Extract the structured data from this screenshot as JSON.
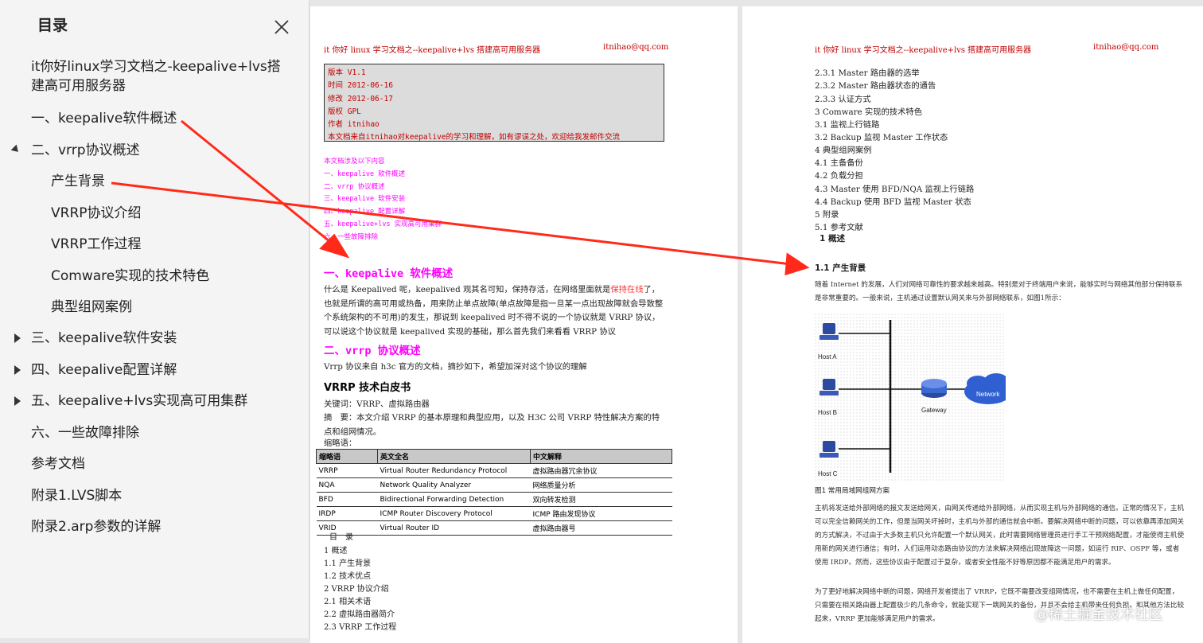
{
  "sidebar": {
    "title": "目录",
    "items": [
      {
        "label": "it你好linux学习文档之-keepalive+lvs搭建高可用服务器"
      },
      {
        "label": "一、keepalive软件概述"
      },
      {
        "label": "二、vrrp协议概述"
      },
      {
        "label": "产生背景"
      },
      {
        "label": "VRRP协议介绍"
      },
      {
        "label": "VRRP工作过程"
      },
      {
        "label": "Comware实现的技术特色"
      },
      {
        "label": "典型组网案例"
      },
      {
        "label": "三、keepalive软件安装"
      },
      {
        "label": "四、keepalive配置详解"
      },
      {
        "label": "五、keepalive+lvs实现高可用集群"
      },
      {
        "label": "六、一些故障排除"
      },
      {
        "label": "参考文档"
      },
      {
        "label": "附录1.LVS脚本"
      },
      {
        "label": "附录2.arp参数的详解"
      }
    ]
  },
  "page1": {
    "header_left": "it 你好 linux 学习文档之--keepalive+lvs 搭建高可用服务器",
    "header_right": "itnihao@qq.com",
    "info_lines": [
      "版本 V1.1",
      "时间 2012-06-16",
      "修改 2012-06-17",
      "版权 GPL",
      "作者 itnihao",
      "本文档来自itnihao对keepalive的学习和理解，如有谬误之处，欢迎给我发邮件交流"
    ],
    "contents_lines": [
      "本文档涉及以下内容",
      "一、keepalive 软件概述",
      "二、vrrp 协议概述",
      "三、keepalive 软件安装",
      "四、keepalive 配置详解",
      "五、keepalive+lvs 实现高可用集群",
      "六、一些故障排除"
    ],
    "h1": "一、keepalive 软件概述",
    "p1a": "什么是 Keepalived 呢，keepalived 观其名可知，保持存活，在网络里面就是",
    "p1b": "保持在线",
    "p1c": "了，也就是所谓的高可用或热备，用来防止单点故障(单点故障是指一旦某一点出现故障就会导致整个系统架构的不可用)的发生，那说到 keepalived 时不得不说的一个协议就是 VRRP 协议，可以说这个协议就是 keepalived 实现的基础，那么首先我们来看看 VRRP 协议",
    "h2": "二、vrrp 协议概述",
    "p2": "Vrrp 协议来自 h3c 官方的文档，摘抄如下，希望加深对这个协议的理解",
    "h3": "VRRP 技术白皮书",
    "keywords": "关键词：VRRP、虚拟路由器",
    "abstract": "摘　要：本文介绍 VRRP 的基本原理和典型应用，以及 H3C 公司 VRRP 特性解决方案的特点和组网情况。",
    "abbr_label": "缩略语：",
    "table_headers": [
      "缩略语",
      "英文全名",
      "中文解释"
    ],
    "table_rows": [
      [
        "VRRP",
        "Virtual Router Redundancy Protocol",
        "虚拟路由器冗余协议"
      ],
      [
        "NQA",
        "Network Quality Analyzer",
        "网络质量分析"
      ],
      [
        "BFD",
        "Bidirectional Forwarding Detection",
        "双向转发检测"
      ],
      [
        "IRDP",
        "ICMP Router Discovery Protocol",
        "ICMP 路由发现协议"
      ],
      [
        "VRID",
        "Virtual Router ID",
        "虚拟路由器号"
      ]
    ],
    "toc_lines": [
      "目　录",
      "1  概述",
      "1.1  产生背景",
      "1.2  技术优点",
      "2 VRRP 协议介绍",
      "2.1  相关术语",
      "2.2  虚拟路由器简介",
      "2.3 VRRP 工作过程"
    ]
  },
  "page2": {
    "header_left": "it 你好 linux 学习文档之--keepalive+lvs 搭建高可用服务器",
    "header_right": "itnihao@qq.com",
    "toc_lines": [
      "2.3.1 Master 路由器的选举",
      "2.3.2 Master 路由器状态的通告",
      "2.3.3  认证方式",
      "3 Comware 实现的技术特色",
      "3.1  监视上行链路",
      "3.2 Backup 监视 Master 工作状态",
      "4  典型组网案例",
      "4.1  主备备份",
      "4.2  负载分担",
      "4.3 Master 使用 BFD/NQA 监视上行链路",
      "4.4 Backup 使用 BFD 监视 Master 状态",
      "5  附录",
      "5.1  参考文献"
    ],
    "section1": "1   概述",
    "section11": "1.1   产生背景",
    "intro": "随着 Internet 的发展，人们对网络可靠性的要求越来越高。特别是对于终端用户来说，能够实时与网络其他部分保持联系是非常重要的。一般来说，主机通过设置默认网关来与外部网络联系，如图1所示：",
    "diagram": {
      "host_a": "Host A",
      "host_b": "Host B",
      "host_c": "Host C",
      "gateway": "Gateway",
      "network": "Network"
    },
    "figure_caption": "图1   常用局域网组网方案",
    "para1": "主机将发送给外部网络的报文发送给网关，由网关传递给外部网络，从而实现主机与外部网络的通信。正常的情况下，主机可以完全信赖网关的工作，但是当网关坏掉时，主机与外部的通信就会中断。要解决网络中断的问题，可以依靠再添加网关的方式解决，不过由于大多数主机只允许配置一个默认网关，此时需要网络管理员进行手工干预网络配置，才能使得主机使用新的网关进行通信；有时，人们运用动态路由协议的方法来解决网络出现故障这一问题，如运行 RIP、OSPF 等，或者使用 IRDP。然而，这些协议由于配置过于复杂，或者安全性能不好等原因都不能满足用户的需求。",
    "para2": "为了更好地解决网络中断的问题，网络开发者提出了 VRRP，它既不需要改变组网情况，也不需要在主机上做任何配置，只需要在相关路由器上配置极少的几条命令，就能实现下一跳网关的备份，并且不会给主机带来任何负担。和其他方法比较起来，VRRP 更加能够满足用户的需求。"
  },
  "watermark": "@稀土掘金技术社区",
  "colors": {
    "arrow": "#ff2a1a",
    "pink": "#ff00ff",
    "red_text": "#c00000"
  }
}
